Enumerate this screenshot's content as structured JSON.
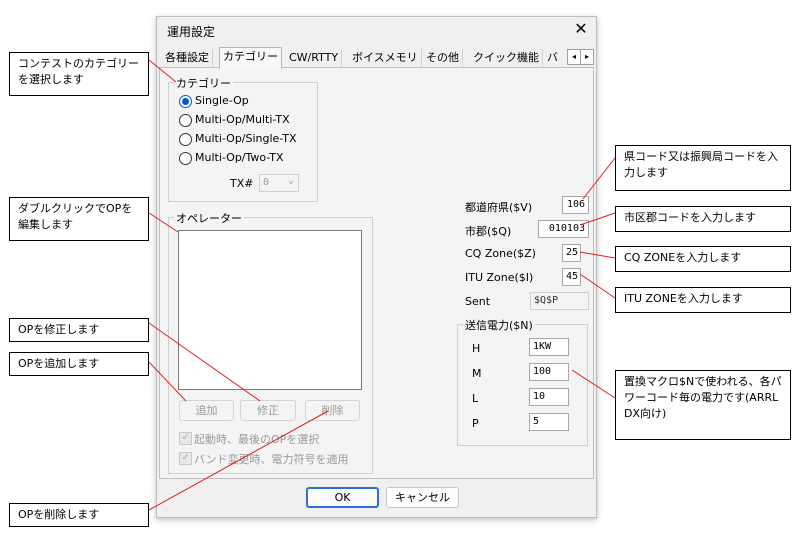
{
  "dialog": {
    "title": "運用設定",
    "close_glyph": "✕",
    "tabs": [
      "各種設定",
      "カテゴリー",
      "CW/RTTY",
      "ボイスメモリ",
      "その他",
      "クイック機能",
      "バ"
    ],
    "active_tab": "カテゴリー",
    "tab_scroll_left": "◂",
    "tab_scroll_right": "▸",
    "category": {
      "group_label": "カテゴリー",
      "options": [
        "Single-Op",
        "Multi-Op/Multi-TX",
        "Multi-Op/Single-TX",
        "Multi-Op/Two-TX"
      ],
      "selected": "Single-Op",
      "tx_label": "TX#",
      "tx_value": "0",
      "tx_arrow": "⌄"
    },
    "operator": {
      "group_label": "オペレーター",
      "add_button": "追加",
      "edit_button": "修正",
      "delete_button": "削除",
      "check_last_op": "起動時、最後のOPを選択",
      "check_band_power": "バンド変更時、電力符号を適用",
      "check_mark": "✓"
    },
    "fields": {
      "pref_label": "都道府県($V)",
      "pref_value": "106",
      "city_label": "市郡($Q)",
      "city_value": "010103",
      "cq_label": "CQ Zone($Z)",
      "cq_value": "25",
      "itu_label": "ITU Zone($I)",
      "itu_value": "45",
      "sent_label": "Sent",
      "sent_value": "$Q$P"
    },
    "power": {
      "group_label": "送信電力($N)",
      "rows": [
        {
          "label": "H",
          "value": "1KW"
        },
        {
          "label": "M",
          "value": "100"
        },
        {
          "label": "L",
          "value": "10"
        },
        {
          "label": "P",
          "value": "5"
        }
      ]
    },
    "ok_button": "OK",
    "cancel_button": "キャンセル"
  },
  "callouts": {
    "category": "コンテストのカテゴリーを選択します",
    "pref": "県コード又は振興局コードを入力します",
    "city": "市区郡コードを入力します",
    "cq": "CQ ZONEを入力します",
    "itu": "ITU ZONEを入力します",
    "operator": "ダブルクリックでOPを編集します",
    "edit": "OPを修正します",
    "add": "OPを追加します",
    "power": "置換マクロ$Nで使われる、各パワーコード毎の電力です(ARRL DX向け)",
    "delete": "OPを削除します"
  }
}
